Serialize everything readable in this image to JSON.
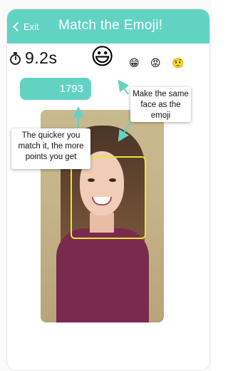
{
  "header": {
    "exit_label": "Exit",
    "title": "Match the Emoji!",
    "color": "#62d3c3"
  },
  "timer": {
    "icon": "stopwatch-icon",
    "value": "9.2s"
  },
  "emojis": {
    "target": "😃",
    "queue": [
      "😁",
      "😡",
      "🤨"
    ]
  },
  "score": {
    "value": "1793"
  },
  "callouts": {
    "same_face": [
      "Make the same",
      "face as the emoji"
    ],
    "quicker": [
      "The quicker you",
      "match it, the more",
      "points you get"
    ]
  },
  "face_box_color": "#e8e43a"
}
